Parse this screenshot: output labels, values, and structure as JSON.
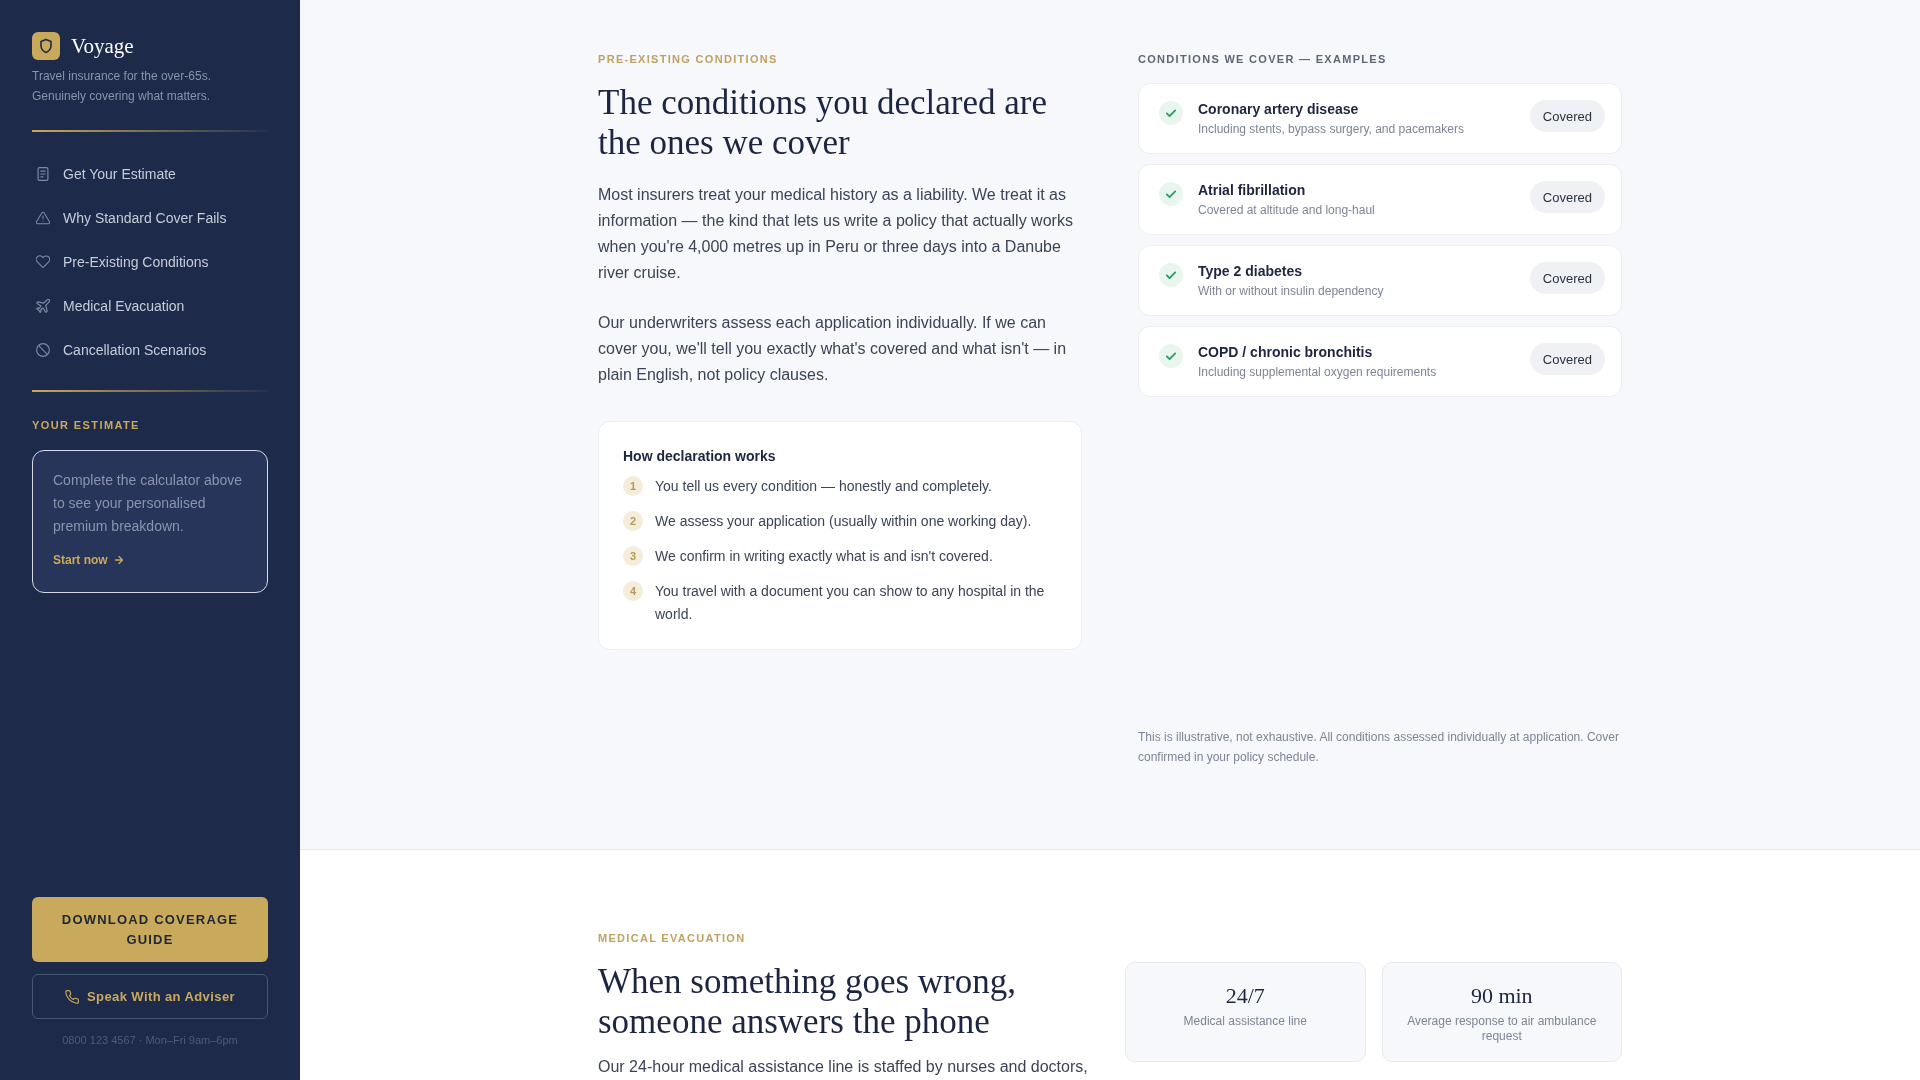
{
  "sidebar": {
    "brand": {
      "name": "Voyage",
      "tagline": "Travel insurance for the over-65s. Genuinely covering what matters."
    },
    "nav": [
      {
        "label": "Get Your Estimate",
        "selected": false
      },
      {
        "label": "Why Standard Cover Fails",
        "selected": false
      },
      {
        "label": "Pre-Existing Conditions",
        "selected": false
      },
      {
        "label": "Medical Evacuation",
        "selected": false
      },
      {
        "label": "Cancellation Scenarios",
        "selected": false
      }
    ],
    "estimate": {
      "heading": "YOUR ESTIMATE",
      "text": "Complete the calculator above to see your personalised premium breakdown.",
      "link": "Start now"
    },
    "download_button": {
      "label": "DOWNLOAD COVERAGE GUIDE"
    },
    "adviser_button": {
      "label": "Speak With an Adviser"
    },
    "contact": "0800 123 4567 · Mon–Fri 9am–6pm"
  },
  "conditions_section": {
    "eyebrow": "PRE-EXISTING CONDITIONS",
    "heading": "The conditions you declared are the ones we cover",
    "paragraphs": [
      "Most insurers treat your medical history as a liability. We treat it as information — the kind that lets us write a policy that actually works when you're 4,000 metres up in Peru or three days into a Danube river cruise.",
      "Our underwriters assess each application individually. If we can cover you, we'll tell you exactly what's covered and what isn't — in plain English, not policy clauses."
    ],
    "declaration_card": {
      "title": "How declaration works",
      "steps": [
        {
          "number": "1",
          "text": "You tell us every condition — honestly and completely."
        },
        {
          "number": "2",
          "text": "We assess your application (usually within one working day)."
        },
        {
          "number": "3",
          "text": "We confirm in writing exactly what is and isn't covered."
        },
        {
          "number": "4",
          "text": "You travel with a document you can show to any hospital in the world."
        }
      ]
    },
    "examples": {
      "heading": "CONDITIONS WE COVER — EXAMPLES",
      "items": [
        {
          "name": "Coronary artery disease",
          "detail": "Including stents, bypass surgery, and pacemakers",
          "badge": "Covered"
        },
        {
          "name": "Atrial fibrillation",
          "detail": "Covered at altitude and long-haul",
          "badge": "Covered"
        },
        {
          "name": "Type 2 diabetes",
          "detail": "With or without insulin dependency",
          "badge": "Covered"
        },
        {
          "name": "COPD / chronic bronchitis",
          "detail": "Including supplemental oxygen requirements",
          "badge": "Covered"
        }
      ]
    },
    "note": "This is illustrative, not exhaustive. All conditions assessed individually at application. Cover confirmed in your policy schedule."
  },
  "evacuation_section": {
    "eyebrow": "MEDICAL EVACUATION",
    "heading": "When something goes wrong, someone answers the phone",
    "paragraph": "Our 24-hour medical assistance line is staffed by nurses and doctors,",
    "stats": [
      {
        "value": "24/7",
        "label": "Medical assistance line"
      },
      {
        "value": "90 min",
        "label": "Average response to air ambulance request"
      }
    ]
  }
}
